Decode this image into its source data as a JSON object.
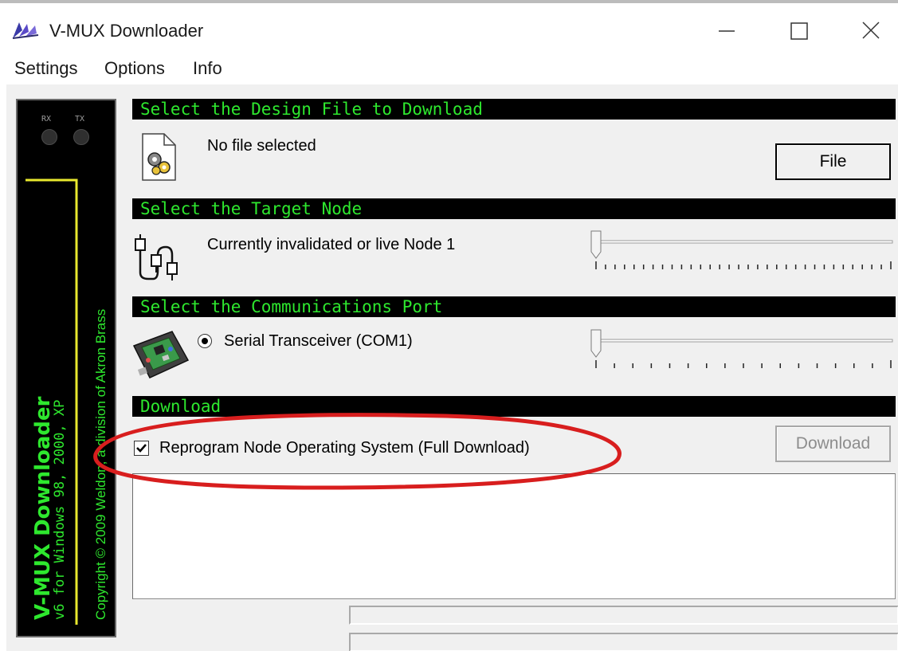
{
  "window": {
    "title": "V-MUX Downloader"
  },
  "menu": {
    "items": [
      "Settings",
      "Options",
      "Info"
    ]
  },
  "banner": {
    "rx_label": "RX",
    "tx_label": "TX",
    "product": "V-MUX Downloader",
    "version_line": "v6 for Windows 98, 2000, XP",
    "copyright": "Copyright © 2009 Weldon, a division of Akron Brass"
  },
  "sections": {
    "design_file": {
      "header": "Select the Design File to Download",
      "status": "No file selected",
      "file_button": "File"
    },
    "target_node": {
      "header": "Select the Target Node",
      "status": "Currently invalidated or live Node 1"
    },
    "comm_port": {
      "header": "Select the Communications Port",
      "option_label": "Serial Transceiver (COM1)",
      "option_selected": true
    },
    "download": {
      "header": "Download",
      "reprogram_label": "Reprogram Node Operating System (Full Download)",
      "reprogram_checked": true,
      "download_button": "Download",
      "download_enabled": false
    }
  },
  "log": {
    "text": ""
  },
  "colors": {
    "section_header_bg": "#000000",
    "section_header_text": "#2ee82e",
    "banner_accent": "#e8e82e",
    "annotation": "#d81e1e"
  },
  "icons": {
    "app": "feather-icon",
    "design_file": "gear-document-icon",
    "target_node": "cable-connector-icon",
    "comm_port": "circuit-board-icon"
  }
}
